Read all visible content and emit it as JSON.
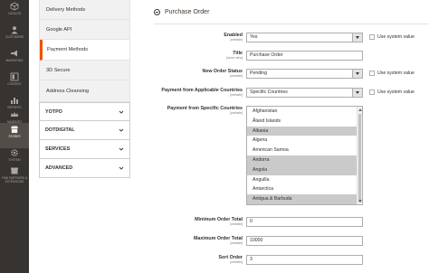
{
  "admin_nav": [
    {
      "name": "catalog",
      "label": "Catalog",
      "icon": "cube-icon"
    },
    {
      "name": "customers",
      "label": "Customers",
      "icon": "person-icon"
    },
    {
      "name": "marketing",
      "label": "Marketing",
      "icon": "megaphone-icon"
    },
    {
      "name": "content",
      "label": "Content",
      "icon": "layout-icon"
    },
    {
      "name": "reports",
      "label": "Reports",
      "icon": "bar-chart-icon"
    },
    {
      "name": "magento",
      "label": "Magento",
      "icon": "crown-icon"
    },
    {
      "name": "stores",
      "label": "Stores",
      "icon": "store-icon",
      "active": true
    },
    {
      "name": "system",
      "label": "System",
      "icon": "gear-icon"
    },
    {
      "name": "partners",
      "label": "Find Partners & Extensions",
      "icon": "box-icon"
    }
  ],
  "config_sidebar": {
    "items": [
      "Delivery Methods",
      "Google API",
      "Payment Methods",
      "3D Secure",
      "Address Cleansing"
    ],
    "active_item": "Payment Methods",
    "sections": [
      "YOTPO",
      "DOTDIGITAL",
      "SERVICES",
      "ADVANCED"
    ]
  },
  "section": {
    "title": "Purchase Order"
  },
  "fields": {
    "enabled": {
      "label": "Enabled",
      "scope": "[website]",
      "value": "Yes",
      "system": "Use system value"
    },
    "title": {
      "label": "Title",
      "scope": "[store view]",
      "value": "Purchase Order"
    },
    "new_order_status": {
      "label": "New Order Status",
      "scope": "[website]",
      "value": "Pending",
      "system": "Use system value"
    },
    "applicable_countries": {
      "label": "Payment from Applicable Countries",
      "scope": "[website]",
      "value": "Specific Countries",
      "system": "Use system value"
    },
    "specific_countries": {
      "label": "Payment from Specific Countries",
      "scope": "[website]",
      "options": [
        {
          "text": "Afghanistan",
          "selected": false
        },
        {
          "text": "Åland Islands",
          "selected": false
        },
        {
          "text": "Albania",
          "selected": true
        },
        {
          "text": "Algeria",
          "selected": false
        },
        {
          "text": "American Samoa",
          "selected": false
        },
        {
          "text": "Andorra",
          "selected": true
        },
        {
          "text": "Angola",
          "selected": true
        },
        {
          "text": "Anguilla",
          "selected": false
        },
        {
          "text": "Antarctica",
          "selected": false
        },
        {
          "text": "Antigua & Barbuda",
          "selected": true
        }
      ]
    },
    "min_total": {
      "label": "Minimum Order Total",
      "scope": "[website]",
      "value": "0"
    },
    "max_total": {
      "label": "Maximum Order Total",
      "scope": "[website]",
      "value": "10000"
    },
    "sort_order": {
      "label": "Sort Order",
      "scope": "[website]",
      "value": "3"
    }
  }
}
